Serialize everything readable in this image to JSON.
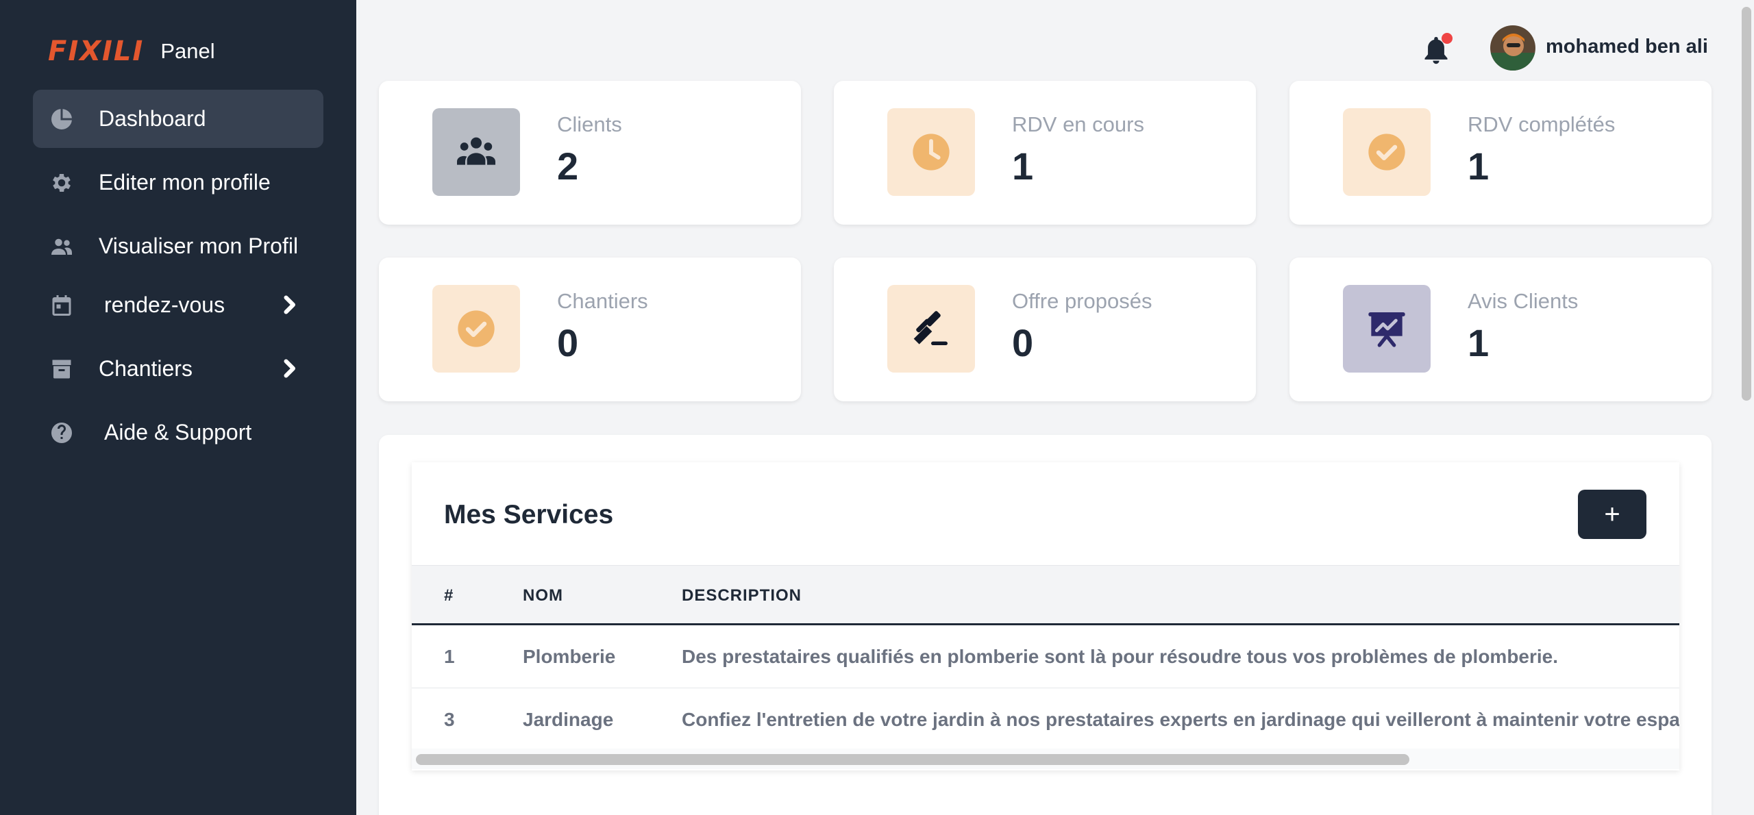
{
  "brand": {
    "logo": "FIXILI",
    "panel": "Panel",
    "logo_color": "#e4572e"
  },
  "sidebar": {
    "items": [
      {
        "label": "Dashboard",
        "icon": "pie-chart-icon",
        "active": true
      },
      {
        "label": "Editer mon profile",
        "icon": "gear-icon"
      },
      {
        "label": "Visualiser mon Profil",
        "icon": "users-icon"
      },
      {
        "label": "rendez-vous",
        "icon": "calendar-icon",
        "has_submenu": true
      },
      {
        "label": "Chantiers",
        "icon": "archive-icon",
        "has_submenu": true
      },
      {
        "label": "Aide & Support",
        "icon": "question-icon"
      }
    ]
  },
  "header": {
    "user_name": "mohamed ben ali",
    "notification_dot_color": "#ef4444"
  },
  "stats": [
    {
      "label": "Clients",
      "value": "2",
      "icon": "users-group-icon",
      "icon_bg": "#b8bcc4"
    },
    {
      "label": "RDV en cours",
      "value": "1",
      "icon": "clock-icon",
      "icon_bg": "#fbe8d3"
    },
    {
      "label": "RDV complétés",
      "value": "1",
      "icon": "check-circle-icon",
      "icon_bg": "#fbe8d3"
    },
    {
      "label": "Chantiers",
      "value": "0",
      "icon": "check-circle-icon",
      "icon_bg": "#fbe8d3"
    },
    {
      "label": "Offre proposés",
      "value": "0",
      "icon": "gavel-icon",
      "icon_bg": "#fbe8d3"
    },
    {
      "label": "Avis Clients",
      "value": "1",
      "icon": "presentation-chart-icon",
      "icon_bg": "#c4c3d6"
    }
  ],
  "services": {
    "title": "Mes Services",
    "add_label": "+",
    "columns": [
      "#",
      "NOM",
      "DESCRIPTION"
    ],
    "rows": [
      {
        "num": "1",
        "nom": "Plomberie",
        "description": "Des prestataires qualifiés en plomberie sont là pour résoudre tous vos problèmes de plomberie."
      },
      {
        "num": "3",
        "nom": "Jardinage",
        "description": "Confiez l'entretien de votre jardin à nos prestataires experts en jardinage qui veilleront à maintenir votre espa"
      }
    ]
  }
}
